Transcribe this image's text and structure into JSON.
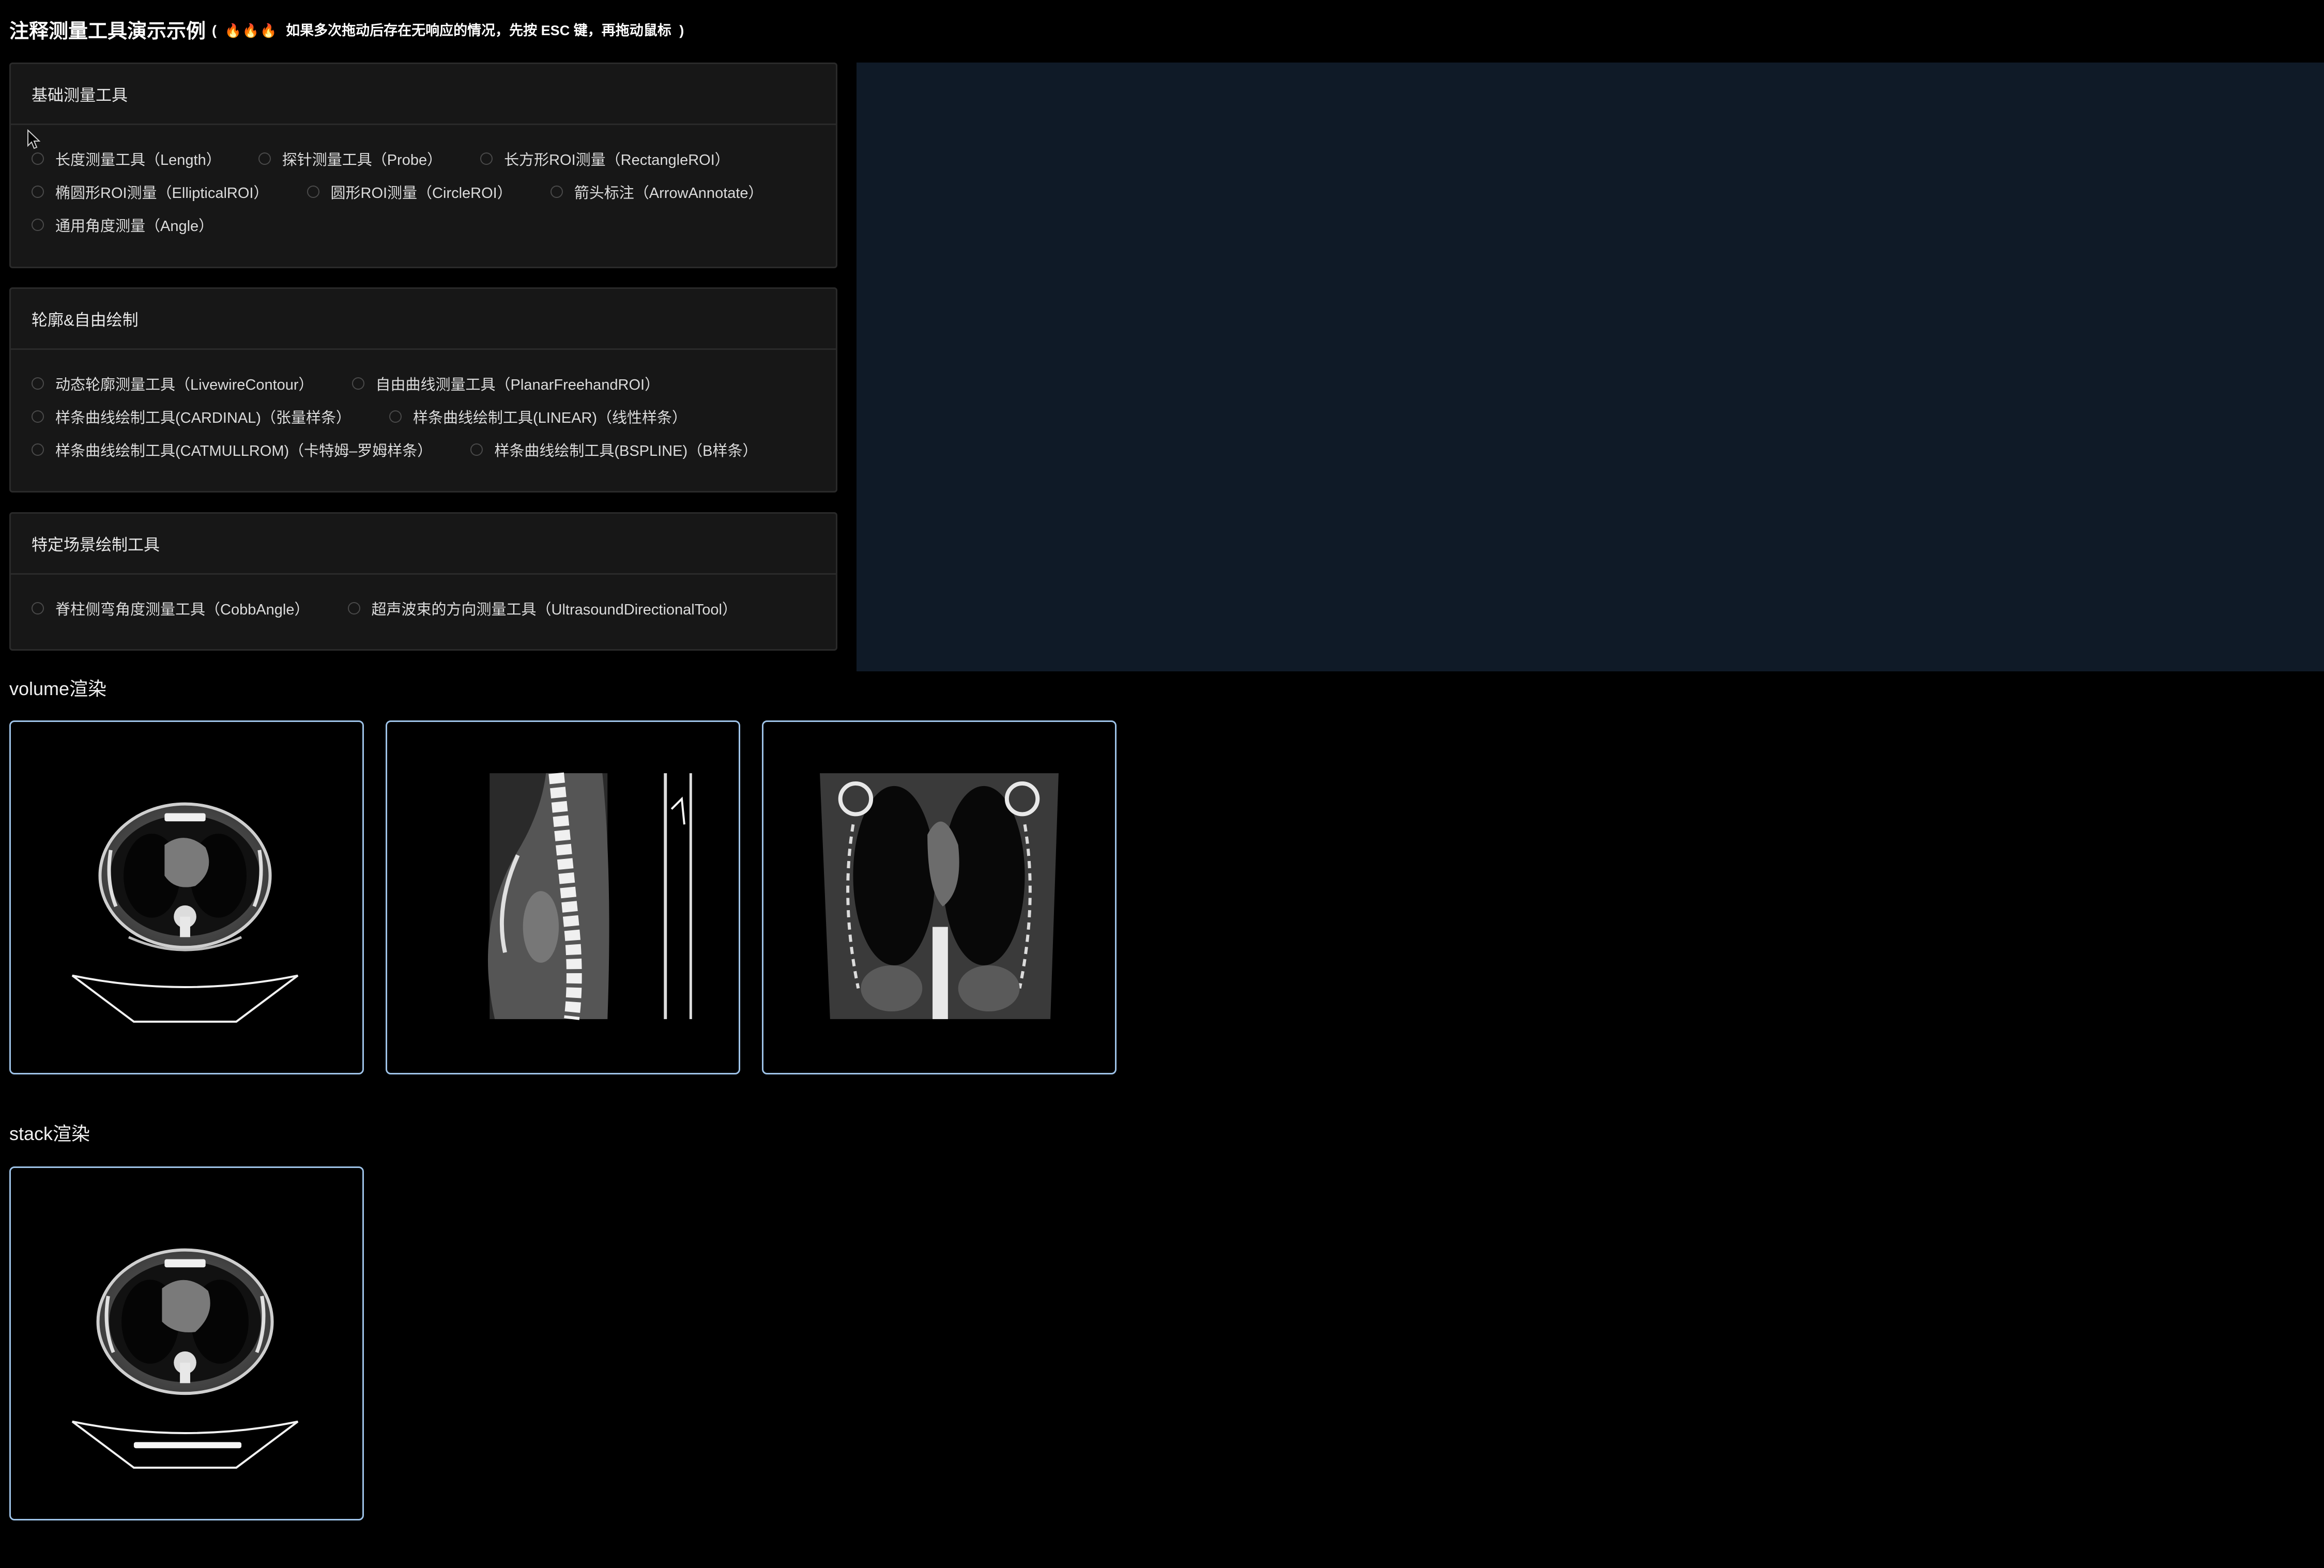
{
  "header": {
    "title": "注释测量工具演示示例",
    "note_open": "(",
    "note_icons": "🔥🔥🔥",
    "note_text": "如果多次拖动后存在无响应的情况，先按 ESC 键，再拖动鼠标",
    "note_close": ")"
  },
  "panels": {
    "basic": {
      "title": "基础测量工具",
      "options": [
        "长度测量工具（Length）",
        "探针测量工具（Probe）",
        "长方形ROI测量（RectangleROI）",
        "椭圆形ROI测量（EllipticalROI）",
        "圆形ROI测量（CircleROI）",
        "箭头标注（ArrowAnnotate）",
        "通用角度测量（Angle）"
      ]
    },
    "contour": {
      "title": "轮廓&自由绘制",
      "options": [
        "动态轮廓测量工具（LivewireContour）",
        "自由曲线测量工具（PlanarFreehandROI）",
        "样条曲线绘制工具(CARDINAL)（张量样条）",
        "样条曲线绘制工具(LINEAR)（线性样条）",
        "样条曲线绘制工具(CATMULLROM)（卡特姆–罗姆样条）",
        "样条曲线绘制工具(BSPLINE)（B样条）"
      ]
    },
    "special": {
      "title": "特定场景绘制工具",
      "options": [
        "脊柱侧弯角度测量工具（CobbAngle）",
        "超声波束的方向测量工具（UltrasoundDirectionalTool）"
      ]
    }
  },
  "sections": {
    "volume_title": "volume渲染",
    "stack_title": "stack渲染"
  },
  "icons": {
    "flame": "flame-icon",
    "cursor": "mouse-pointer-icon",
    "radio": "radio-unchecked-icon"
  },
  "colors": {
    "background": "#000000",
    "panel_bg": "#171717",
    "viewport_border": "#9ec3e8",
    "large_viewport_bg": "#0f1a27"
  }
}
